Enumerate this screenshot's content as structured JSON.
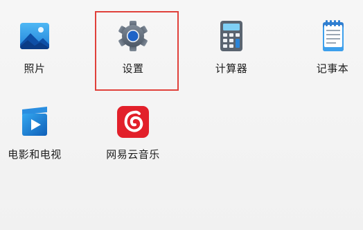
{
  "start_menu": {
    "pinned_apps": [
      {
        "label": "照片",
        "icon": "photos-icon"
      },
      {
        "label": "设置",
        "icon": "settings-gear-icon"
      },
      {
        "label": "计算器",
        "icon": "calculator-icon"
      },
      {
        "label": "记事本",
        "icon": "notepad-icon"
      },
      {
        "label": "电影和电视",
        "icon": "movies-tv-icon"
      },
      {
        "label": "网易云音乐",
        "icon": "netease-cloud-music-icon"
      }
    ],
    "highlight_color": "#e0403a"
  }
}
